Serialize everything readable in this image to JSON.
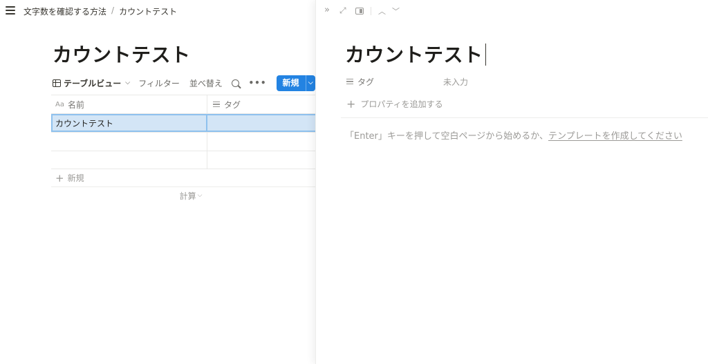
{
  "breadcrumb": {
    "parent": "文字数を確認する方法",
    "separator": "/",
    "current": "カウントテスト"
  },
  "page": {
    "title": "カウントテスト"
  },
  "toolbar": {
    "view_label": "テーブルビュー",
    "filter_label": "フィルター",
    "sort_label": "並べ替え",
    "more_label": "•••",
    "new_label": "新規",
    "accent_color": "#2383e2"
  },
  "table": {
    "columns": [
      {
        "icon": "Aa",
        "label": "名前"
      },
      {
        "icon": "list-icon",
        "label": "タグ"
      }
    ],
    "rows": [
      {
        "name": "カウントテスト",
        "tag": ""
      },
      {
        "name": "",
        "tag": ""
      },
      {
        "name": "",
        "tag": ""
      }
    ],
    "add_row_label": "新規",
    "calc_label": "計算"
  },
  "peek": {
    "title": "カウントテスト",
    "property": {
      "name": "タグ",
      "value": "未入力"
    },
    "add_property_label": "プロパティを追加する",
    "hint_prefix": "「Enter」キーを押して空白ページから始めるか、",
    "hint_link": "テンプレートを作成してください"
  }
}
